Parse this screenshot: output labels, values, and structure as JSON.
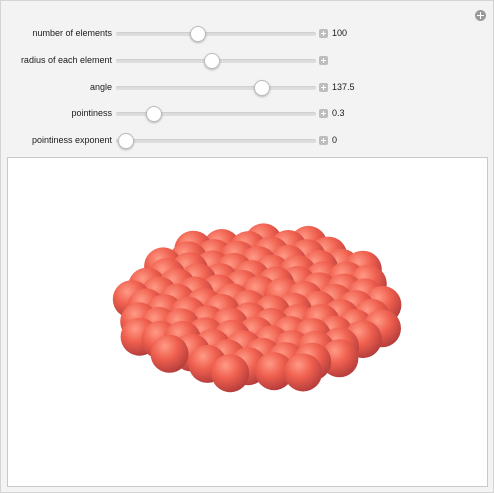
{
  "controls": [
    {
      "id": "number-of-elements",
      "label": "number of elements",
      "value": "100",
      "fraction": 0.41
    },
    {
      "id": "radius-of-each-element",
      "label": "radius of each element",
      "value": "",
      "fraction": 0.48
    },
    {
      "id": "angle",
      "label": "angle",
      "value": "137.5",
      "fraction": 0.73
    },
    {
      "id": "pointiness",
      "label": "pointiness",
      "value": "0.3",
      "fraction": 0.19
    },
    {
      "id": "pointiness-exponent",
      "label": "pointiness exponent",
      "value": "0",
      "fraction": 0.05
    }
  ],
  "render": {
    "sphere_color": "#f0604f",
    "sphere_highlight": "#ff9a86",
    "sphere_shadow": "#b03a3a"
  }
}
